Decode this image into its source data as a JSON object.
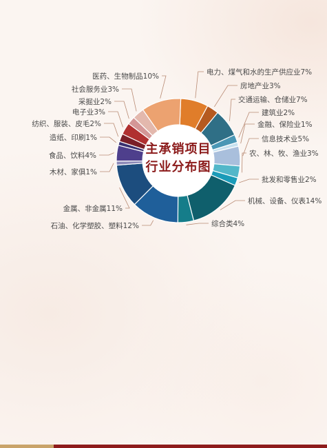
{
  "colors": {
    "title": "#8b1a1a",
    "bar_gold": "#c9a46a",
    "bar_red": "#8e1c1c"
  },
  "chart_data": {
    "type": "pie",
    "title": "主承销项目\n行业分布图",
    "title_lines": [
      "主承销项目",
      "行业分布图"
    ],
    "slices": [
      {
        "label": "电力、煤气和水的生产供应业7%",
        "value": 7,
        "color": "#e07d2a"
      },
      {
        "label": "房地产业3%",
        "value": 3,
        "color": "#b55a20"
      },
      {
        "label": "交通运输、仓储业7%",
        "value": 7,
        "color": "#2f6f86"
      },
      {
        "label": "建筑业2%",
        "value": 2,
        "color": "#4a97b5"
      },
      {
        "label": "金融、保险业1%",
        "value": 1,
        "color": "#c6e1ef"
      },
      {
        "label": "信息技术业5%",
        "value": 5,
        "color": "#a9bfdc"
      },
      {
        "label": "农、林、牧、渔业3%",
        "value": 3,
        "color": "#52b7c9"
      },
      {
        "label": "批发和零售业2%",
        "value": 2,
        "color": "#1a9bb8"
      },
      {
        "label": "机械、设备、仪表14%",
        "value": 14,
        "color": "#0f5f6c"
      },
      {
        "label": "综合类4%",
        "value": 4,
        "color": "#157d8a"
      },
      {
        "label": "石油、化学塑胶、塑料12%",
        "value": 12,
        "color": "#1f5f9a"
      },
      {
        "label": "金属、非金属11%",
        "value": 11,
        "color": "#1c4d7e"
      },
      {
        "label": "木材、家俱1%",
        "value": 1,
        "color": "#8d8ab8"
      },
      {
        "label": "食品、饮料4%",
        "value": 4,
        "color": "#4e3f8c"
      },
      {
        "label": "造纸、印刷1%",
        "value": 1,
        "color": "#3a3170"
      },
      {
        "label": "纺织、服装、皮毛2%",
        "value": 2,
        "color": "#7a1f28"
      },
      {
        "label": "电子业3%",
        "value": 3,
        "color": "#b03030"
      },
      {
        "label": "采掘业2%",
        "value": 2,
        "color": "#d49696"
      },
      {
        "label": "社会服务业3%",
        "value": 3,
        "color": "#e3b8ad"
      },
      {
        "label": "医药、生物制品10%",
        "value": 10,
        "color": "#eca270"
      }
    ]
  }
}
